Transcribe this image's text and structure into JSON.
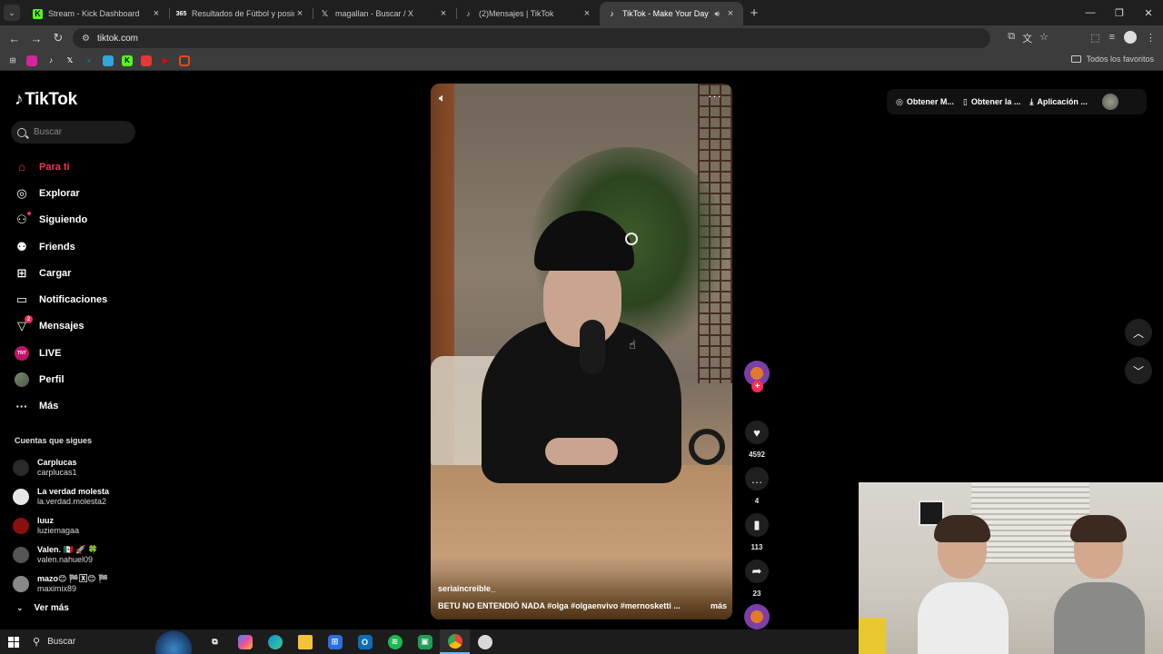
{
  "browser": {
    "tabs": [
      {
        "title": "Stream - Kick Dashboard",
        "favicon": "kick-icon",
        "color": "#53fc18"
      },
      {
        "title": "Resultados de Fútbol y posiciones",
        "favicon": "365-icon",
        "color": "#ffffff"
      },
      {
        "title": "magallan - Buscar / X",
        "favicon": "x-icon",
        "color": "#ffffff"
      },
      {
        "title": "(2)Mensajes | TikTok",
        "favicon": "tiktok-icon",
        "color": "#ffffff"
      },
      {
        "title": "TikTok - Make Your Day",
        "favicon": "tiktok-icon",
        "color": "#ffffff",
        "active": true
      }
    ],
    "url": "tiktok.com",
    "bookmarks_all": "Todos los favoritos"
  },
  "sidebar": {
    "brand": "TikTok",
    "search_placeholder": "Buscar",
    "nav": [
      {
        "label": "Para ti",
        "icon": "home-icon",
        "active": true
      },
      {
        "label": "Explorar",
        "icon": "compass-icon"
      },
      {
        "label": "Siguiendo",
        "icon": "following-icon"
      },
      {
        "label": "Friends",
        "icon": "friends-icon"
      },
      {
        "label": "Cargar",
        "icon": "upload-icon"
      },
      {
        "label": "Notificaciones",
        "icon": "notifications-icon"
      },
      {
        "label": "Mensajes",
        "icon": "messages-icon",
        "badge": "2"
      },
      {
        "label": "LIVE",
        "icon": "live-icon"
      },
      {
        "label": "Perfil",
        "icon": "profile-icon"
      },
      {
        "label": "Más",
        "icon": "more-icon"
      }
    ],
    "following_title": "Cuentas que sigues",
    "following": [
      {
        "name": "Carplucas",
        "username": "carplucas1",
        "color": "#2a2a2a"
      },
      {
        "name": "La verdad molesta",
        "username": "la.verdad.molesta2",
        "color": "#e6e6e6"
      },
      {
        "name": "luuz",
        "username": "luziemagaa",
        "color": "#8a1010"
      },
      {
        "name": "Valen. 🇲🇽 🚀 🍀",
        "username": "valen.nahuel09",
        "color": "#555555"
      },
      {
        "name": "mazo😊 🏁🅇😊 🏁",
        "username": "maximix89",
        "color": "#888888"
      }
    ],
    "see_more": "Ver más"
  },
  "video": {
    "author": "seriaincreible_",
    "description": "BETU NO ENTENDIÓ NADA #olga #olgaenvivo #mernosketti ...",
    "more": "más",
    "likes": "4592",
    "comments": "4",
    "saves": "113",
    "shares": "23"
  },
  "header": {
    "get_coins": "Obtener M...",
    "get_app": "Obtener la ...",
    "pc_app": "Aplicación ..."
  },
  "taskbar": {
    "search_label": "Buscar"
  },
  "colors": {
    "accent": "#fe2c55",
    "background": "#000000"
  }
}
